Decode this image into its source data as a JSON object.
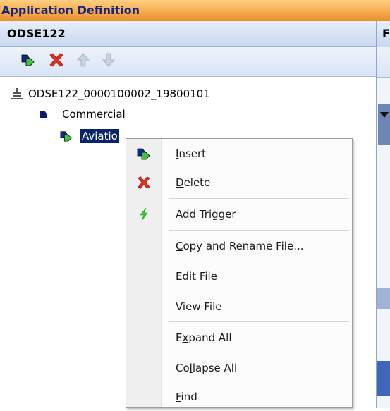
{
  "window": {
    "title": "Application Definition"
  },
  "panel": {
    "title": "ODSE122",
    "right_header_fragment": "F"
  },
  "toolbar": {
    "insert_icon": "insert-node-icon",
    "delete_icon": "delete-x-icon",
    "move_up_icon": "arrow-up-icon",
    "move_down_icon": "arrow-down-icon"
  },
  "tree": {
    "root": "ODSE122_0000100002_19800101",
    "level1": "Commercial",
    "level2": "Aviatio"
  },
  "context_menu": {
    "items": [
      {
        "pre": "",
        "key": "I",
        "post": "nsert",
        "icon": "insert-node-icon"
      },
      {
        "pre": "",
        "key": "D",
        "post": "elete",
        "icon": "delete-x-icon"
      },
      {
        "pre": "Add ",
        "key": "T",
        "post": "rigger",
        "icon": "lightning-icon"
      },
      {
        "pre": "",
        "key": "C",
        "post": "opy and Rename File...",
        "icon": ""
      },
      {
        "pre": "",
        "key": "E",
        "post": "dit File",
        "icon": ""
      },
      {
        "pre": "View File",
        "key": "",
        "post": "",
        "icon": ""
      },
      {
        "pre": "E",
        "key": "x",
        "post": "pand All",
        "icon": ""
      },
      {
        "pre": "Co",
        "key": "l",
        "post": "lapse All",
        "icon": ""
      },
      {
        "pre": "",
        "key": "F",
        "post": "ind",
        "icon": ""
      }
    ]
  },
  "colors": {
    "title_bar": "#f5a84a",
    "title_text": "#14257d",
    "selection": "#0a246a",
    "delete_red": "#e2301d",
    "lightning_green": "#2fd32f"
  }
}
